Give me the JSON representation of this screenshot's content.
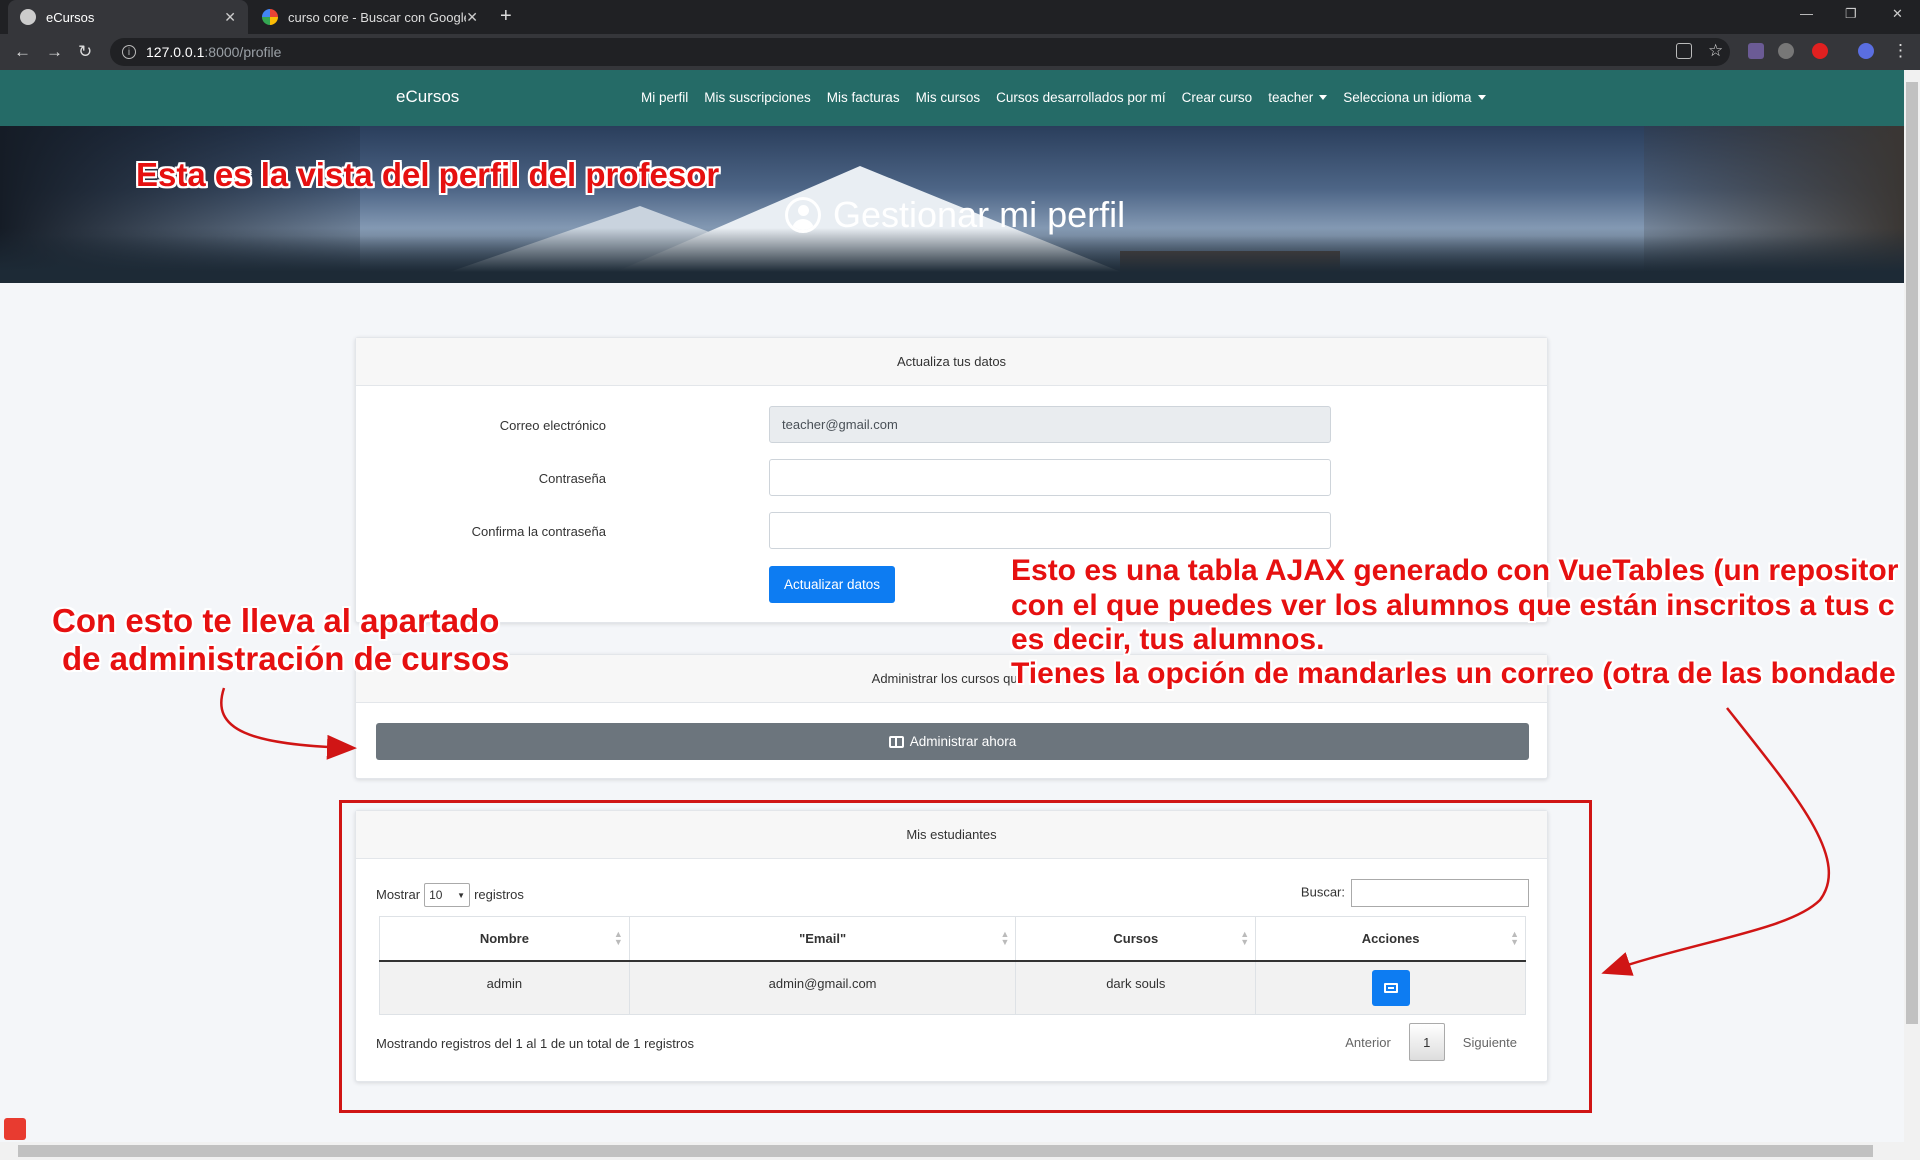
{
  "browser": {
    "tabs": [
      {
        "title": "eCursos"
      },
      {
        "title": "curso core - Buscar con Google"
      }
    ],
    "url_host": "127.0.0.1",
    "url_rest": ":8000/profile"
  },
  "navbar": {
    "brand": "eCursos",
    "links": [
      "Mi perfil",
      "Mis suscripciones",
      "Mis facturas",
      "Mis cursos",
      "Cursos desarrollados por mí",
      "Crear curso"
    ],
    "user_menu": "teacher",
    "language_menu": "Selecciona un idioma"
  },
  "hero": {
    "title": "Gestionar mi perfil"
  },
  "profile_card": {
    "header": "Actualiza tus datos",
    "email_label": "Correo electrónico",
    "email_value": "teacher@gmail.com",
    "password_label": "Contraseña",
    "confirm_label": "Confirma la contraseña",
    "submit_label": "Actualizar datos"
  },
  "admin_card": {
    "header": "Administrar los cursos que i",
    "button_label": "Administrar ahora"
  },
  "students_card": {
    "header": "Mis estudiantes",
    "show_label": "Mostrar",
    "page_size": "10",
    "records_label": "registros",
    "search_label": "Buscar:",
    "columns": [
      "Nombre",
      "\"Email\"",
      "Cursos",
      "Acciones"
    ],
    "rows": [
      {
        "name": "admin",
        "email": "admin@gmail.com",
        "course": "dark souls"
      }
    ],
    "info": "Mostrando registros del 1 al 1 de un total de 1 registros",
    "prev": "Anterior",
    "page": "1",
    "next": "Siguiente"
  },
  "annotations": {
    "top": "Esta es la vista del perfil del profesor",
    "left_line1": "Con esto te lleva al apartado",
    "left_line2": "de administración de cursos",
    "right_line1": "Esto es una tabla AJAX generado con VueTables (un repositor",
    "right_line2": "con el que puedes ver los alumnos que están inscritos a tus c",
    "right_line3": "es decir, tus alumnos.",
    "right_line4": "Tienes la opción de mandarles un correo (otra de las bondade"
  },
  "colors": {
    "navbar": "#256b67",
    "primary": "#0d7cf2",
    "secondary": "#6c757d",
    "annotation": "#e61010"
  }
}
